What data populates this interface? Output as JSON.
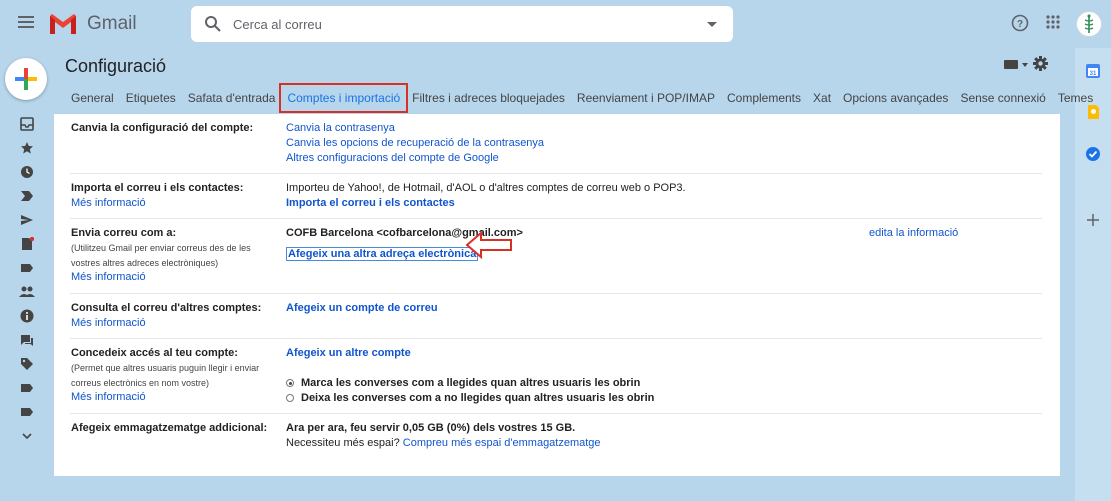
{
  "app": {
    "name": "Gmail"
  },
  "search": {
    "placeholder": "Cerca al correu"
  },
  "page": {
    "title": "Configuració"
  },
  "tabs": [
    {
      "label": "General"
    },
    {
      "label": "Etiquetes"
    },
    {
      "label": "Safata d'entrada"
    },
    {
      "label": "Comptes i importació",
      "active": true
    },
    {
      "label": "Filtres i adreces bloquejades"
    },
    {
      "label": "Reenviament i POP/IMAP"
    },
    {
      "label": "Complements"
    },
    {
      "label": "Xat"
    },
    {
      "label": "Opcions avançades"
    },
    {
      "label": "Sense connexió"
    },
    {
      "label": "Temes"
    }
  ],
  "sections": {
    "account": {
      "label": "Canvia la configuració del compte:",
      "links": [
        "Canvia la contrasenya",
        "Canvia les opcions de recuperació de la contrasenya",
        "Altres configuracions del compte de Google"
      ]
    },
    "import": {
      "label": "Importa el correu i els contactes:",
      "more": "Més informació",
      "text": "Importeu de Yahoo!, de Hotmail, d'AOL o d'altres comptes de correu web o POP3.",
      "action": "Importa el correu i els contactes"
    },
    "sendas": {
      "label": "Envia correu com a:",
      "sub1": "(Utilitzeu Gmail per enviar correus des de les",
      "sub2": "vostres altres adreces electròniques)",
      "more": "Més informació",
      "address": "COFB Barcelona <cofbarcelona@gmail.com>",
      "edit": "edita la informació",
      "add": "Afegeix una altra adreça electrònica"
    },
    "check": {
      "label": "Consulta el correu d'altres comptes:",
      "more": "Més informació",
      "action": "Afegeix un compte de correu"
    },
    "grant": {
      "label": "Concedeix accés al teu compte:",
      "sub1": "(Permet que altres usuaris puguin llegir i enviar",
      "sub2": "correus electrònics en nom vostre)",
      "more": "Més informació",
      "action": "Afegeix un altre compte",
      "option1": "Marca les converses com a llegides quan altres usuaris les obrin",
      "option2": "Deixa les converses com a no llegides quan altres usuaris les obrin"
    },
    "storage": {
      "label": "Afegeix emmagatzematge addicional:",
      "text": "Ara per ara, feu servir 0,05 GB (0%) dels vostres 15 GB.",
      "question": "Necessiteu més espai?",
      "link": "Compreu més espai d'emmagatzematge"
    }
  },
  "colors": {
    "accent": "#1a73e8",
    "link": "#1155cc",
    "highlight": "#d93025",
    "background": "#b7d6ec"
  }
}
